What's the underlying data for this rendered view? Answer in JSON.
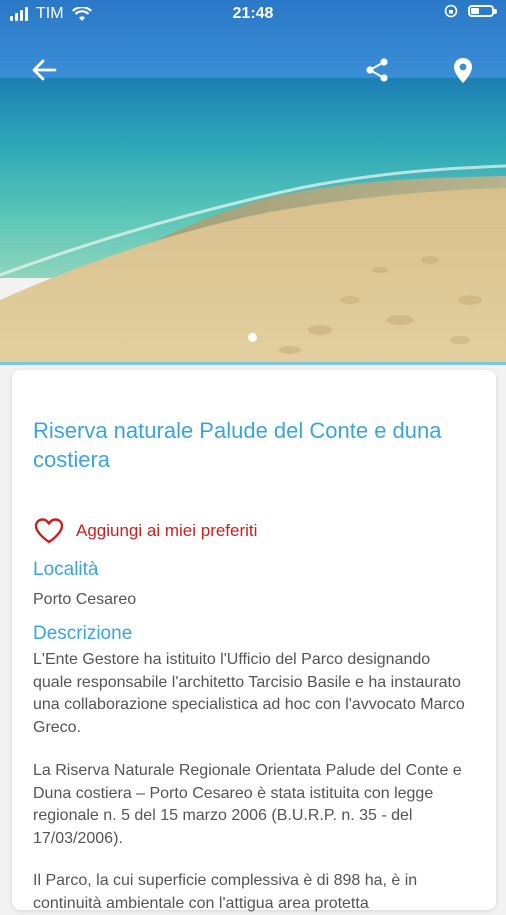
{
  "status_bar": {
    "carrier": "TIM",
    "time": "21:48"
  },
  "nav": {
    "back_icon": "arrow-left-icon",
    "share_icon": "share-icon",
    "location_icon": "map-pin-icon"
  },
  "gallery": {
    "page_count": 1,
    "active_page": 1
  },
  "detail": {
    "title": "Riserva naturale Palude del Conte e duna costiera",
    "favorite_label": "Aggiungi ai miei preferiti",
    "location_heading": "Località",
    "location_value": "Porto Cesareo",
    "description_heading": "Descrizione",
    "description_p1": "L'Ente Gestore ha istituito l'Ufficio del Parco designando quale responsabile l'architetto Tarcisio Basile e ha instaurato una collaborazione specialistica ad hoc con l'avvocato Marco Greco.",
    "description_p2": "La Riserva Naturale Regionale Orientata Palude del Conte e Duna costiera – Porto Cesareo è stata istituita con legge regionale n. 5 del 15 marzo 2006 (B.U.R.P. n. 35 - del 17/03/2006).",
    "description_p3": "Il Parco, la cui superficie complessiva è di 898 ha, è in continuità ambientale con l'attigua area protetta"
  },
  "colors": {
    "accent": "#3aa4dd",
    "favorite": "#c8201f"
  }
}
